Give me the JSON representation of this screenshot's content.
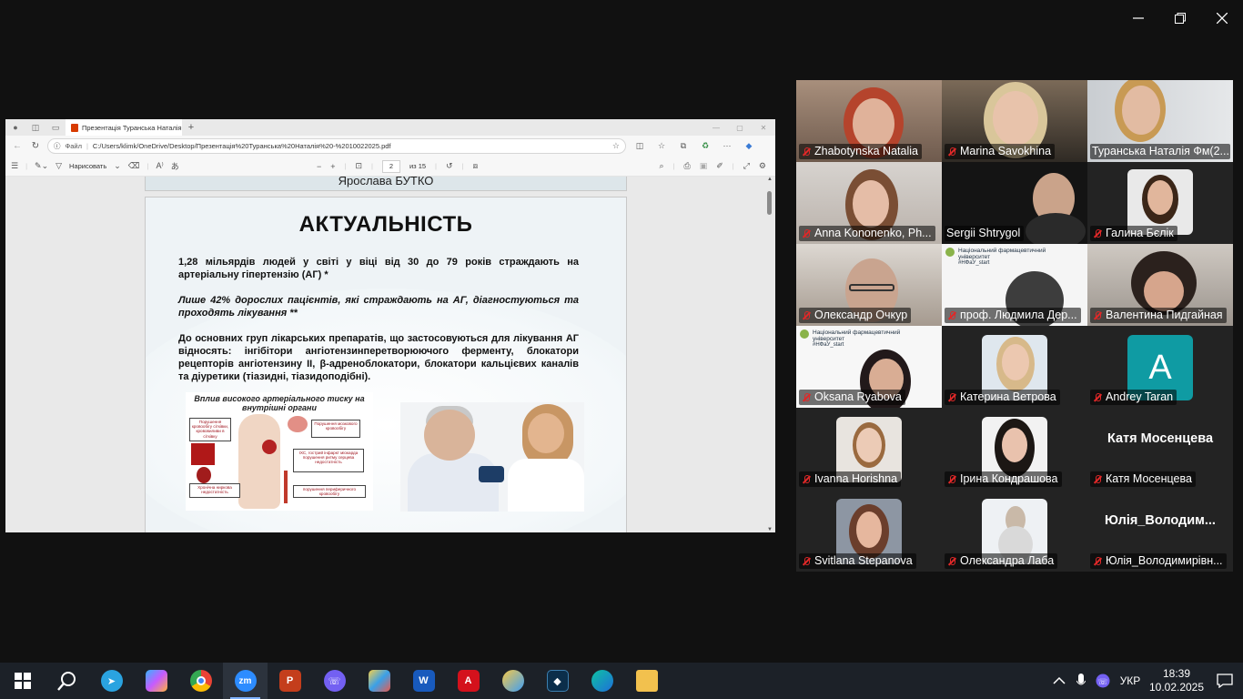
{
  "window_controls": {
    "minimize_icon": "minimize-icon",
    "restore_icon": "restore-icon",
    "close_icon": "close-icon"
  },
  "edge": {
    "tab_title": "Презентація Туранська Наталія",
    "address_prefix": "Файл",
    "url": "C:/Users/klimk/OneDrive/Desktop/Презентація%20Туранська%20Наталія%20-%2010022025.pdf",
    "toolbar": {
      "draw_label": "Нарисовать",
      "page_current": "2",
      "page_total": "из 15"
    }
  },
  "pdf": {
    "prev_page_text": "Ярослава БУТКО",
    "slide": {
      "title": "АКТУАЛЬНІСТЬ",
      "p1": "1,28 мільярдів людей у світі у віці від 30 до 79 років страждають на артеріальну гіпертензію (АГ) *",
      "p2": "Лише 42% дорослих пацієнтів, які страждають на АГ, діагностуються та проходять лікування **",
      "p3": "До основних груп лікарських препаратів, що застосовуються для лікування АГ відносять: інгібітори ангіотензинперетворюючого ферменту, блокатори рецепторів ангіотензину II, β-адреноблокатори, блокатори кальцієвих каналів та діуретики (тіазидні, тіазидоподібні).",
      "infographic_title": "Вплив високого артеріального тиску на внутрішні органи",
      "boxes": {
        "retina": "Порушення кровообігу сітківки, крововиливи в сітківку",
        "brain": "Порушення мозкового кровообігу",
        "heart": "ІХС, гострий інфаркт міокарда порушення ритму серцева недостатність",
        "kidney": "Хронічна ниркова недостатність",
        "vessels": "порушення периферичного кровообігу"
      }
    }
  },
  "participants": [
    {
      "name": "Zhabotynska Natalia",
      "muted": true,
      "video": true
    },
    {
      "name": "Marina Savokhina",
      "muted": true,
      "video": true
    },
    {
      "name": "Туранська Наталія Фм(2...",
      "muted": false,
      "video": true,
      "active_speaker": true
    },
    {
      "name": "Anna Kononenko, Ph...",
      "muted": true,
      "video": true
    },
    {
      "name": "Sergii Shtrygol",
      "muted": false,
      "video": true
    },
    {
      "name": "Галина Бєлік",
      "muted": true,
      "video": true
    },
    {
      "name": "Олександр Очкур",
      "muted": true,
      "video": true
    },
    {
      "name": "проф. Людмила Дер...",
      "muted": true,
      "video": true
    },
    {
      "name": "Валентина Пидгайная",
      "muted": true,
      "video": true
    },
    {
      "name": "Oksana Ryabova",
      "muted": true,
      "video": true
    },
    {
      "name": "Катерина Ветрова",
      "muted": true,
      "video": true
    },
    {
      "name": "Andrey Taran",
      "muted": true,
      "video": false,
      "avatar_letter": "A",
      "avatar_color": "#0f9ba3"
    },
    {
      "name": "Ivanna Horishna",
      "muted": true,
      "video": true
    },
    {
      "name": "Ірина Кондрашова",
      "muted": true,
      "video": true
    },
    {
      "name": "Катя Мосенцева",
      "muted": true,
      "video": false,
      "display_name": "Катя Мосенцева"
    },
    {
      "name": "Svitlana Stepanova",
      "muted": true,
      "video": true
    },
    {
      "name": "Олександра Лаба",
      "muted": true,
      "video": true
    },
    {
      "name": "Юлія_Володимирівн...",
      "muted": true,
      "video": false,
      "display_name": "Юлія_Володим..."
    }
  ],
  "university_banner": {
    "line1": "Національний фармацевтичний університет",
    "tag": "#НФаУ_start"
  },
  "taskbar": {
    "apps": [
      "start-icon",
      "search-icon",
      "telegram-icon",
      "copilot-icon",
      "chrome-icon",
      "zoom-icon",
      "powerpoint-icon",
      "viber-icon",
      "paint-icon",
      "word-icon",
      "acrobat-icon",
      "photos-icon",
      "dell-icon",
      "edge-icon",
      "explorer-icon"
    ],
    "active_app": "zoom-icon",
    "language": "УКР",
    "time": "18:39",
    "date": "10.02.2025"
  },
  "colors": {
    "active_speaker_border": "#2fd67a",
    "muted_icon": "#e02828",
    "taskbar_bg": "#1c2128"
  }
}
